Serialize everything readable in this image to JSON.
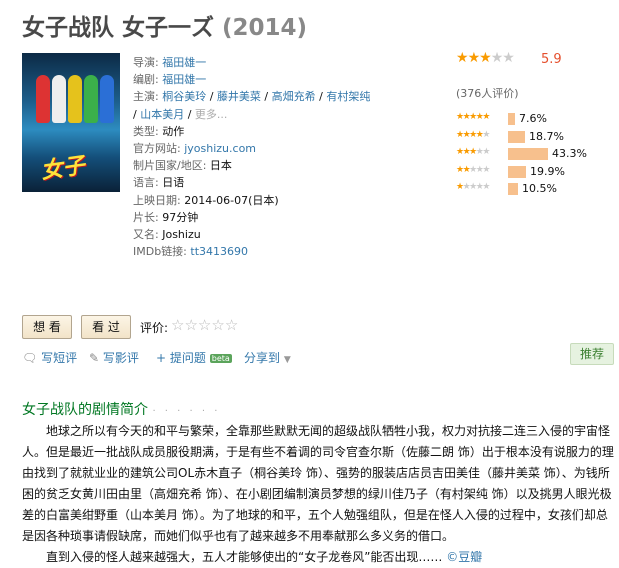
{
  "title": "女子战队 女子一ズ",
  "year": "(2014)",
  "info": {
    "director_label": "导演:",
    "director": "福田雄一",
    "writer_label": "编剧:",
    "writer": "福田雄一",
    "cast_label": "主演:",
    "cast": [
      "桐谷美玲",
      "藤井美菜",
      "高畑充希",
      "有村架纯",
      "山本美月"
    ],
    "cast_more": "更多...",
    "genre_label": "类型:",
    "genre": "动作",
    "site_label": "官方网站:",
    "site": "jyoshizu.com",
    "country_label": "制片国家/地区:",
    "country": "日本",
    "language_label": "语言:",
    "language": "日语",
    "release_label": "上映日期:",
    "release": "2014-06-07(日本)",
    "runtime_label": "片长:",
    "runtime": "97分钟",
    "aka_label": "又名:",
    "aka": "Joshizu",
    "imdb_label": "IMDb链接:",
    "imdb": "tt3413690"
  },
  "rating": {
    "score": "5.9",
    "stars_filled": 3,
    "votes": "(376人评价)",
    "breakdown": [
      {
        "stars": 5,
        "percent": "7.6%",
        "value": 7.6
      },
      {
        "stars": 4,
        "percent": "18.7%",
        "value": 18.7
      },
      {
        "stars": 3,
        "percent": "43.3%",
        "value": 43.3
      },
      {
        "stars": 2,
        "percent": "19.9%",
        "value": 19.9
      },
      {
        "stars": 1,
        "percent": "10.5%",
        "value": 10.5
      }
    ]
  },
  "buttons": {
    "want": "想 看",
    "seen": "看 过",
    "rate_label": "评价:"
  },
  "actions": {
    "short_review": "写短评",
    "review": "写影评",
    "question": "提问题",
    "beta": "beta",
    "share": "分享到",
    "recommend": "推荐"
  },
  "summary": {
    "heading": "女子战队的剧情简介",
    "dots": "· · · · · ·",
    "para1": "地球之所以有今天的和平与繁荣，全靠那些默默无闻的超级战队牺牲小我，权力对抗接二连三入侵的宇宙怪人。但是最近一批战队成员服役期满，于是有些不着调的司令官查尔斯（佐藤二朗 饰）出于根本没有说服力的理由找到了就就业业的建筑公司OL赤木直子（桐谷美玲 饰）、强势的服装店店员吉田美佳（藤井美菜 饰）、为钱所困的贫乏女黄川田由里（高畑充希 饰）、在小剧团编制演员梦想的绿川佳乃子（有村架纯 饰）以及挑男人眼光极差的白富美绀野重（山本美月 饰）。为了地球的和平，五个人勉强组队，但是在怪人入侵的过程中，女孩们却总是因各种琐事请假缺席，而她们似乎也有了越来越多不用奉献那么多义务的借口。",
    "para2": "直到入侵的怪人越来越强大，五人才能够使出的“女子龙卷风”能否出现…… ",
    "source": "©豆瓣"
  }
}
